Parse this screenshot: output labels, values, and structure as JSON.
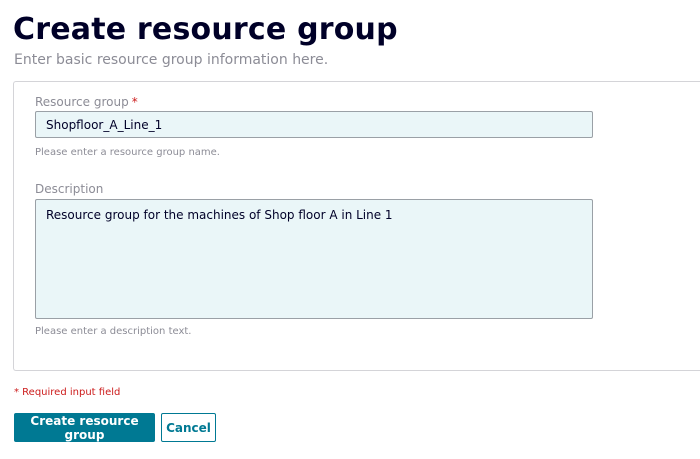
{
  "header": {
    "title": "Create resource group",
    "subtitle": "Enter basic resource group information here."
  },
  "form": {
    "resource_group": {
      "label": "Resource group",
      "required_marker": "*",
      "value": "Shopfloor_A_Line_1",
      "hint": "Please enter a resource group name."
    },
    "description": {
      "label": "Description",
      "value": "Resource group for the machines of Shop floor A in Line 1",
      "hint": "Please enter a description text."
    }
  },
  "footer": {
    "required_note": "* Required input field",
    "create_label": "Create resource group",
    "cancel_label": "Cancel"
  },
  "colors": {
    "accent": "#007993",
    "required": "#cc1b1b",
    "input_bg": "#eaf6f8",
    "title": "#000028"
  }
}
